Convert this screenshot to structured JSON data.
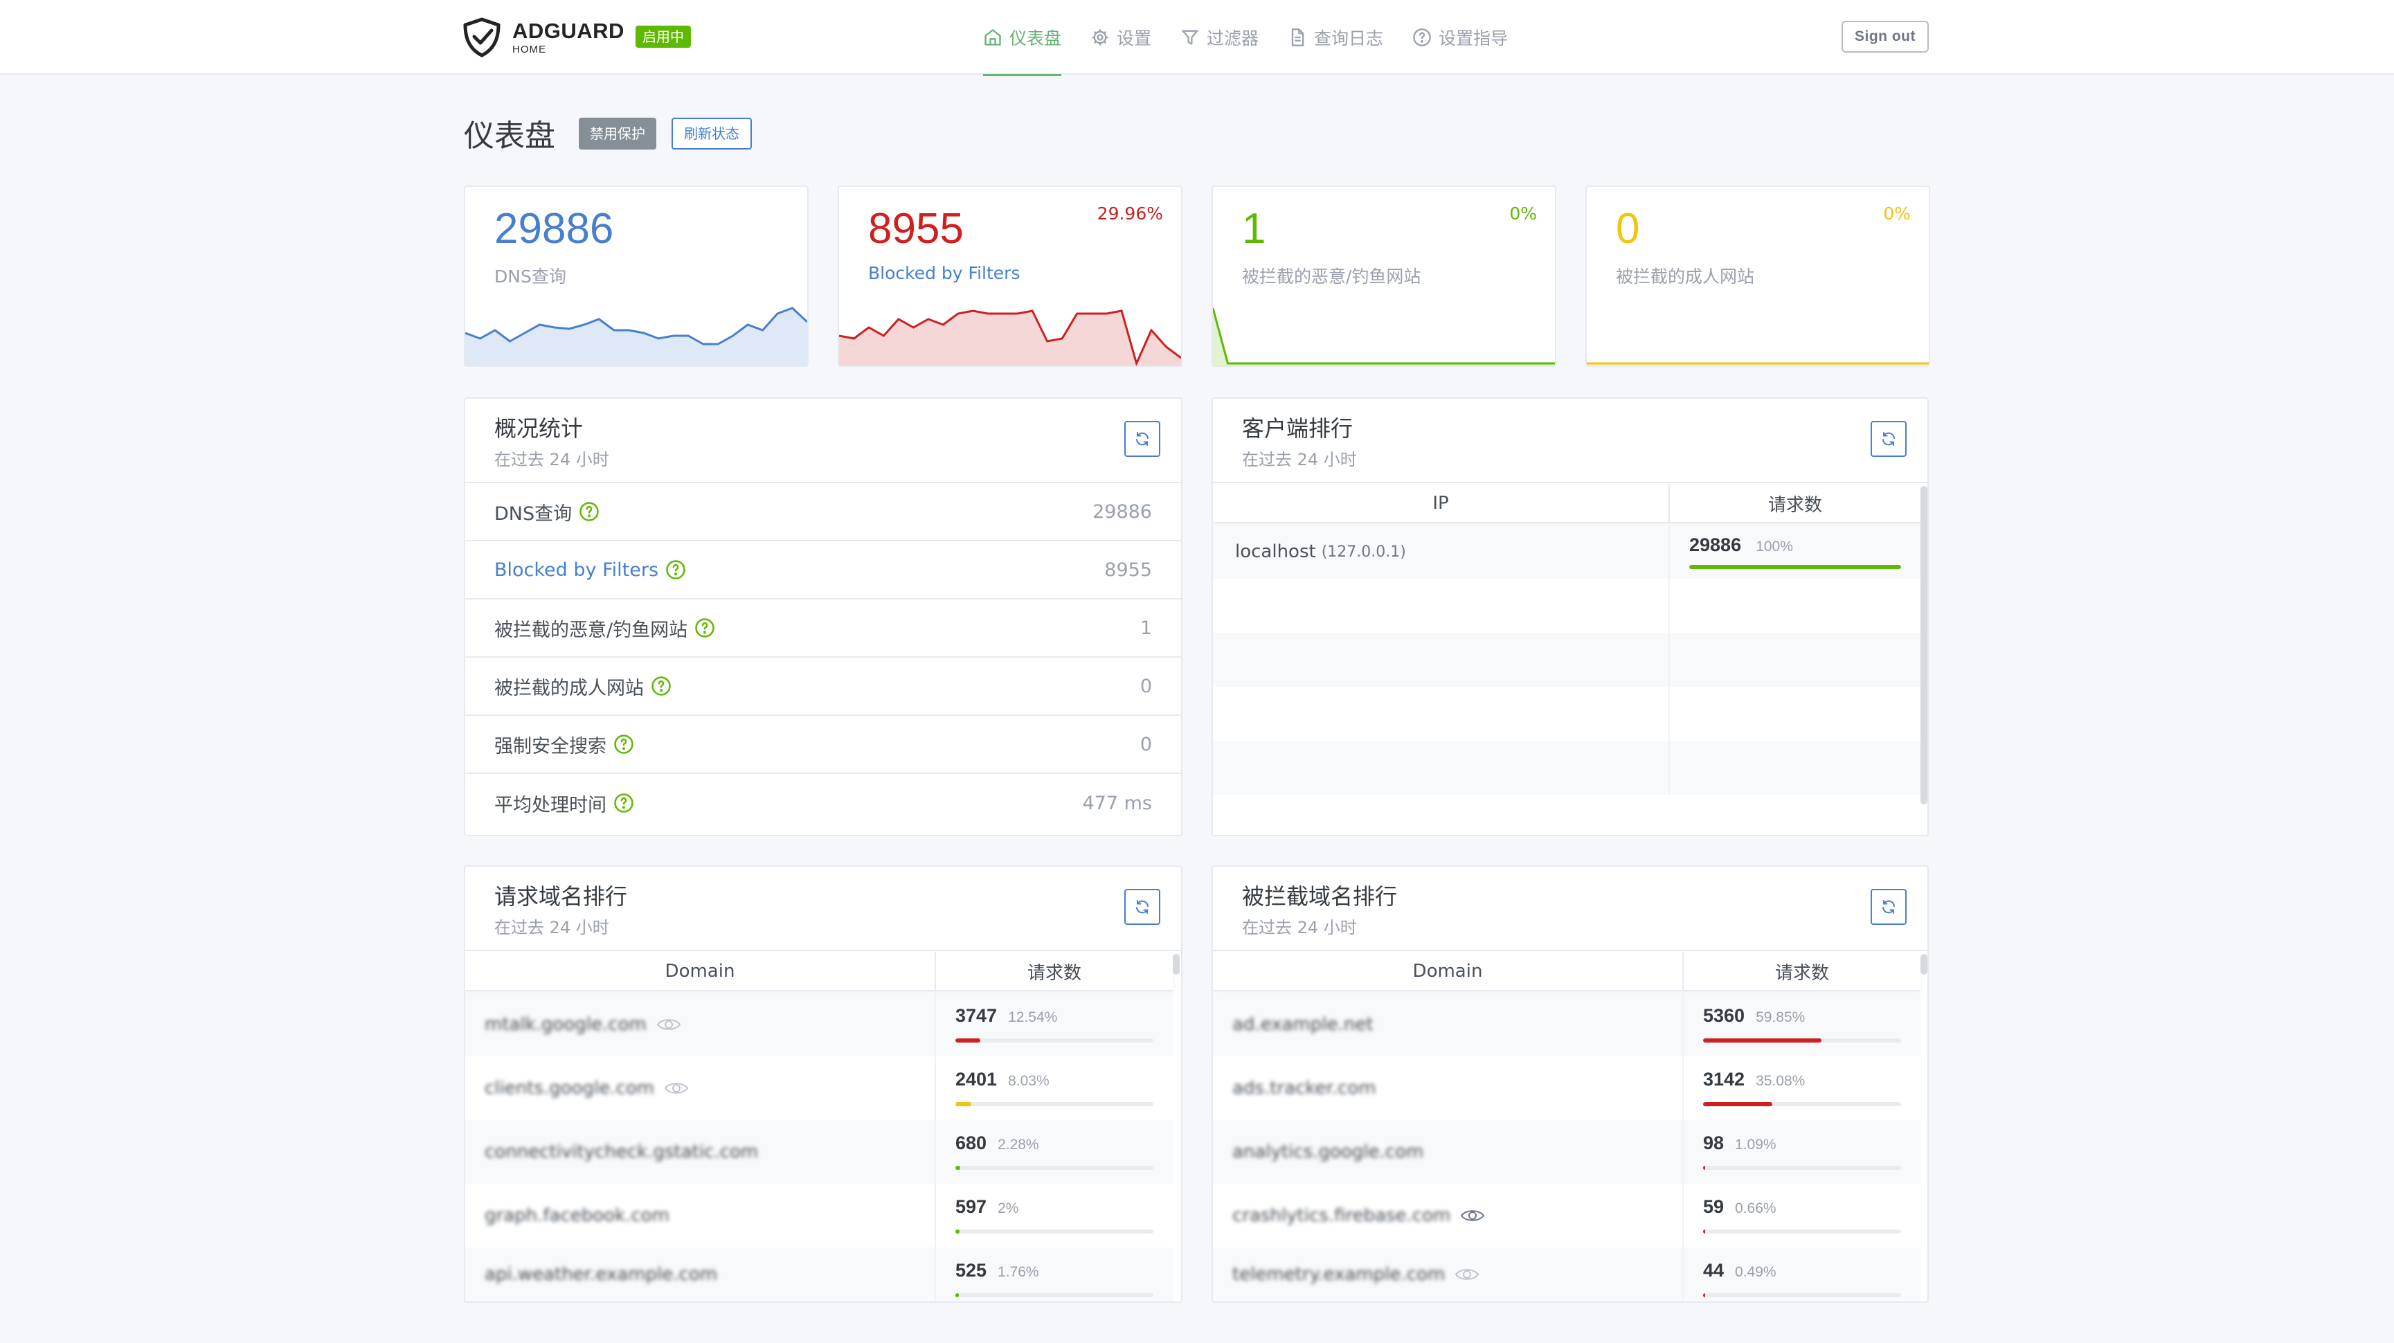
{
  "header": {
    "logo_title": "ADGUARD",
    "logo_sub": "HOME",
    "status_badge": "启用中",
    "nav": [
      {
        "label": "仪表盘",
        "icon": "home-icon"
      },
      {
        "label": "设置",
        "icon": "gear-icon"
      },
      {
        "label": "过滤器",
        "icon": "filter-icon"
      },
      {
        "label": "查询日志",
        "icon": "document-icon"
      },
      {
        "label": "设置指导",
        "icon": "help-circle-icon"
      }
    ],
    "signout": "Sign out"
  },
  "page": {
    "title": "仪表盘",
    "disable_btn": "禁用保护",
    "refresh_btn": "刷新状态"
  },
  "stats": [
    {
      "value": "29886",
      "label": "DNS查询",
      "pct": "",
      "color": "#467fcf",
      "spark": [
        22,
        18,
        24,
        16,
        22,
        28,
        26,
        25,
        28,
        32,
        24,
        24,
        22,
        18,
        20,
        20,
        14,
        14,
        20,
        28,
        24,
        36,
        40,
        30
      ]
    },
    {
      "value": "8955",
      "label": "Blocked by Filters",
      "pct": "29.96%",
      "color": "#cd201f",
      "spark": [
        20,
        18,
        26,
        20,
        32,
        26,
        32,
        28,
        36,
        38,
        36,
        36,
        36,
        38,
        16,
        18,
        36,
        36,
        36,
        38,
        0,
        24,
        12,
        4
      ]
    },
    {
      "value": "1",
      "label": "被拦截的恶意/钓鱼网站",
      "pct": "0%",
      "color": "#5eba00",
      "spark": [
        40,
        0,
        0,
        0,
        0,
        0,
        0,
        0,
        0,
        0,
        0,
        0,
        0,
        0,
        0,
        0,
        0,
        0,
        0,
        0,
        0,
        0,
        0,
        0
      ]
    },
    {
      "value": "0",
      "label": "被拦截的成人网站",
      "pct": "0%",
      "color": "#f1c40f",
      "spark": [
        0,
        0,
        0,
        0,
        0,
        0,
        0,
        0,
        0,
        0,
        0,
        0,
        0,
        0,
        0,
        0,
        0,
        0,
        0,
        0,
        0,
        0,
        0,
        0
      ]
    }
  ],
  "overview": {
    "title": "概况统计",
    "sub": "在过去 24 小时",
    "rows": [
      {
        "label": "DNS查询",
        "value": "29886",
        "blue": false
      },
      {
        "label": "Blocked by Filters",
        "value": "8955",
        "blue": true
      },
      {
        "label": "被拦截的恶意/钓鱼网站",
        "value": "1",
        "blue": false
      },
      {
        "label": "被拦截的成人网站",
        "value": "0",
        "blue": false
      },
      {
        "label": "强制安全搜索",
        "value": "0",
        "blue": false
      },
      {
        "label": "平均处理时间",
        "value": "477 ms",
        "blue": false
      }
    ]
  },
  "clients": {
    "title": "客户端排行",
    "sub": "在过去 24 小时",
    "col_ip": "IP",
    "col_count": "请求数",
    "rows": [
      {
        "name": "localhost",
        "ip": "(127.0.0.1)",
        "count": "29886",
        "pct": "100%",
        "fraction": 1.0
      }
    ]
  },
  "queried": {
    "title": "请求域名排行",
    "sub": "在过去 24 小时",
    "col_domain": "Domain",
    "col_count": "请求数",
    "rows": [
      {
        "domain": "mtalk.google.com",
        "count": "3747",
        "pct": "12.54%",
        "fraction": 0.1254,
        "color": "#cd201f"
      },
      {
        "domain": "clients.google.com",
        "count": "2401",
        "pct": "8.03%",
        "fraction": 0.0803,
        "color": "#f1c40f"
      },
      {
        "domain": "connectivitycheck.gstatic.com",
        "count": "680",
        "pct": "2.28%",
        "fraction": 0.0228,
        "color": "#5eba00"
      },
      {
        "domain": "graph.facebook.com",
        "count": "597",
        "pct": "2%",
        "fraction": 0.02,
        "color": "#5eba00"
      },
      {
        "domain": "api.weather.example.com",
        "count": "525",
        "pct": "1.76%",
        "fraction": 0.0176,
        "color": "#5eba00"
      }
    ]
  },
  "blocked": {
    "title": "被拦截域名排行",
    "sub": "在过去 24 小时",
    "col_domain": "Domain",
    "col_count": "请求数",
    "rows": [
      {
        "domain": "ad.example.net",
        "count": "5360",
        "pct": "59.85%",
        "fraction": 0.5985,
        "color": "#cd201f"
      },
      {
        "domain": "ads.tracker.com",
        "count": "3142",
        "pct": "35.08%",
        "fraction": 0.3508,
        "color": "#cd201f"
      },
      {
        "domain": "analytics.google.com",
        "count": "98",
        "pct": "1.09%",
        "fraction": 0.0109,
        "color": "#cd201f"
      },
      {
        "domain": "crashlytics.firebase.com",
        "count": "59",
        "pct": "0.66%",
        "fraction": 0.0066,
        "color": "#cd201f"
      },
      {
        "domain": "telemetry.example.com",
        "count": "44",
        "pct": "0.49%",
        "fraction": 0.0049,
        "color": "#cd201f"
      }
    ]
  }
}
